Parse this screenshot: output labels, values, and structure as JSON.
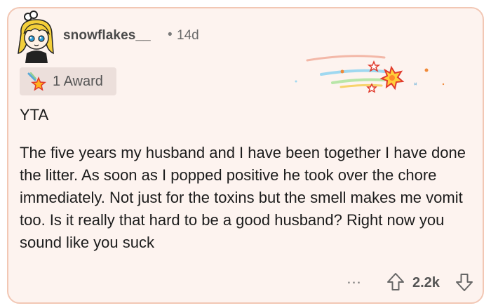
{
  "comment": {
    "username": "snowflakes__",
    "separator": "•",
    "age": "14d",
    "award_label": "1 Award",
    "verdict": "YTA",
    "body": "The five years my husband and I have been together I have done the litter. As soon as I popped positive he took over the chore immediately. Not just for the toxins but the smell makes me vomit too. Is it really that hard to be a good husband? Right now you sound like you suck",
    "more_label": "...",
    "score": "2.2k"
  },
  "icons": {
    "avatar": "avatar-girl-yellow-hair-icon",
    "award": "star-award-icon",
    "award_art": "shooting-star-award-art",
    "upvote": "arrow-up-icon",
    "downvote": "arrow-down-icon",
    "more": "ellipsis-icon"
  },
  "colors": {
    "card_background": "#fdf3ef",
    "card_border": "#f2c7b4",
    "badge_background": "#ecdfdb",
    "text_primary": "#1c1c1c",
    "text_muted": "#6a6a6a"
  }
}
